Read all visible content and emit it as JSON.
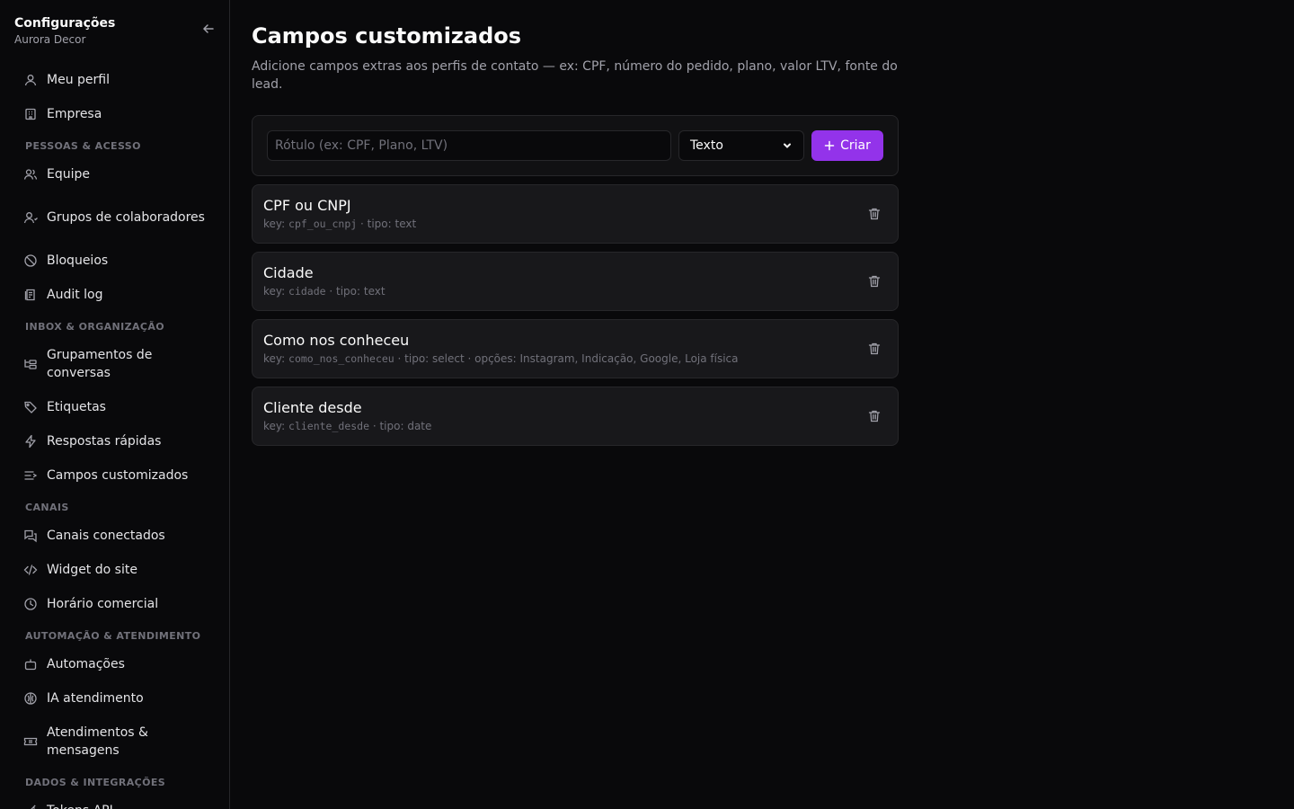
{
  "sidebar": {
    "title": "Configurações",
    "subtitle": "Aurora Decor",
    "items_top": [
      {
        "label": "Meu perfil"
      },
      {
        "label": "Empresa"
      }
    ],
    "sections": [
      {
        "title": "PESSOAS & ACESSO",
        "items": [
          "Equipe",
          "Grupos de colaboradores",
          "Bloqueios",
          "Audit log"
        ]
      },
      {
        "title": "INBOX & ORGANIZAÇÃO",
        "items": [
          "Grupamentos de conversas",
          "Etiquetas",
          "Respostas rápidas",
          "Campos customizados"
        ]
      },
      {
        "title": "CANAIS",
        "items": [
          "Canais conectados",
          "Widget do site",
          "Horário comercial"
        ]
      },
      {
        "title": "AUTOMAÇÃO & ATENDIMENTO",
        "items": [
          "Automações",
          "IA atendimento",
          "Atendimentos & mensagens"
        ]
      },
      {
        "title": "DADOS & INTEGRAÇÕES",
        "items": [
          "Tokens API"
        ]
      }
    ]
  },
  "main": {
    "title": "Campos customizados",
    "description": "Adicione campos extras aos perfis de contato — ex: CPF, número do pedido, plano, valor LTV, fonte do lead.",
    "form": {
      "placeholder": "Rótulo (ex: CPF, Plano, LTV)",
      "type_value": "Texto",
      "create_label": "Criar"
    },
    "fields": [
      {
        "name": "CPF ou CNPJ",
        "key_label": "key:",
        "key": "cpf_ou_cnpj",
        "rest": " · tipo: text"
      },
      {
        "name": "Cidade",
        "key_label": "key:",
        "key": "cidade",
        "rest": " · tipo: text"
      },
      {
        "name": "Como nos conheceu",
        "key_label": "key:",
        "key": "como_nos_conheceu",
        "rest": " · tipo: select · opções: Instagram, Indicação, Google, Loja física"
      },
      {
        "name": "Cliente desde",
        "key_label": "key:",
        "key": "cliente_desde",
        "rest": " · tipo: date"
      }
    ]
  },
  "colors": {
    "accent": "#9333ea",
    "background": "#09090b"
  }
}
